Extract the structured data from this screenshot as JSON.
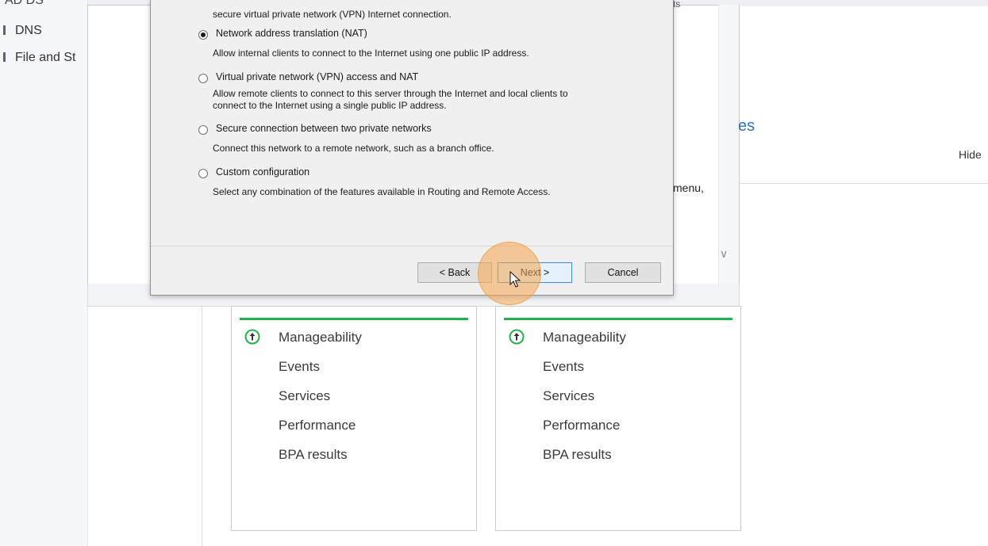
{
  "nav": {
    "partial_top": "AD DS",
    "items": [
      {
        "label": "DNS"
      },
      {
        "label": "File and St"
      }
    ]
  },
  "background": {
    "stale_text": "ts",
    "link_text": "es",
    "hide_label": "Hide",
    "menu_text": "menu,"
  },
  "dialog": {
    "top_desc": "secure virtual private network (VPN) Internet connection.",
    "options": [
      {
        "label": "Network address translation (NAT)",
        "checked": true,
        "desc": [
          "Allow internal clients to connect to the Internet using one public IP address."
        ]
      },
      {
        "label": "Virtual private network (VPN) access and NAT",
        "checked": false,
        "desc": [
          "Allow remote clients to connect to this server through the Internet and local clients to",
          "connect to the Internet using a single public IP address."
        ]
      },
      {
        "label": "Secure connection between two private networks",
        "checked": false,
        "desc": [
          "Connect this network to a remote network, such as a branch office."
        ]
      },
      {
        "label": "Custom configuration",
        "checked": false,
        "desc": [
          "Select any combination of the features available in Routing and Remote Access."
        ]
      }
    ],
    "buttons": {
      "back": "< Back",
      "next": "Next >",
      "cancel": "Cancel"
    }
  },
  "cards": [
    {
      "rows": [
        "Manageability",
        "Events",
        "Services",
        "Performance",
        "BPA results"
      ]
    },
    {
      "rows": [
        "Manageability",
        "Events",
        "Services",
        "Performance",
        "BPA results"
      ]
    }
  ],
  "colors": {
    "accent_green": "#22b14c",
    "link_blue": "#2f73b6",
    "cursor_highlight": "#f5a650"
  }
}
